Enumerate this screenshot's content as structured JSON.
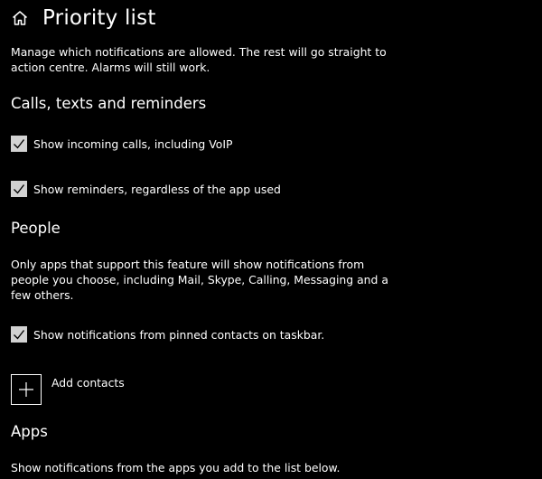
{
  "header": {
    "home_icon": "home-icon",
    "title": "Priority list"
  },
  "intro": {
    "line1": "Manage which notifications are allowed. The rest will go straight to",
    "line2": "action centre. Alarms will still work."
  },
  "calls_section": {
    "title": "Calls, texts and reminders",
    "items": [
      {
        "label": "Show incoming calls, including VoIP",
        "checked": true
      },
      {
        "label": "Show reminders, regardless of the app used",
        "checked": true
      }
    ]
  },
  "people_section": {
    "title": "People",
    "desc_line1": "Only apps that support this feature will show notifications from",
    "desc_line2": "people you choose, including Mail, Skype, Calling, Messaging and a",
    "desc_line3": "few others.",
    "pinned_contacts": {
      "label": "Show notifications from pinned contacts on taskbar.",
      "checked": true
    },
    "add_contacts_label": "Add contacts",
    "add_icon": "plus-icon"
  },
  "apps_section": {
    "title": "Apps",
    "desc": "Show notifications from the apps you add to the list below."
  },
  "colors": {
    "background": "#000000",
    "text": "#ffffff",
    "checkbox_fill": "#d2d2d2"
  }
}
